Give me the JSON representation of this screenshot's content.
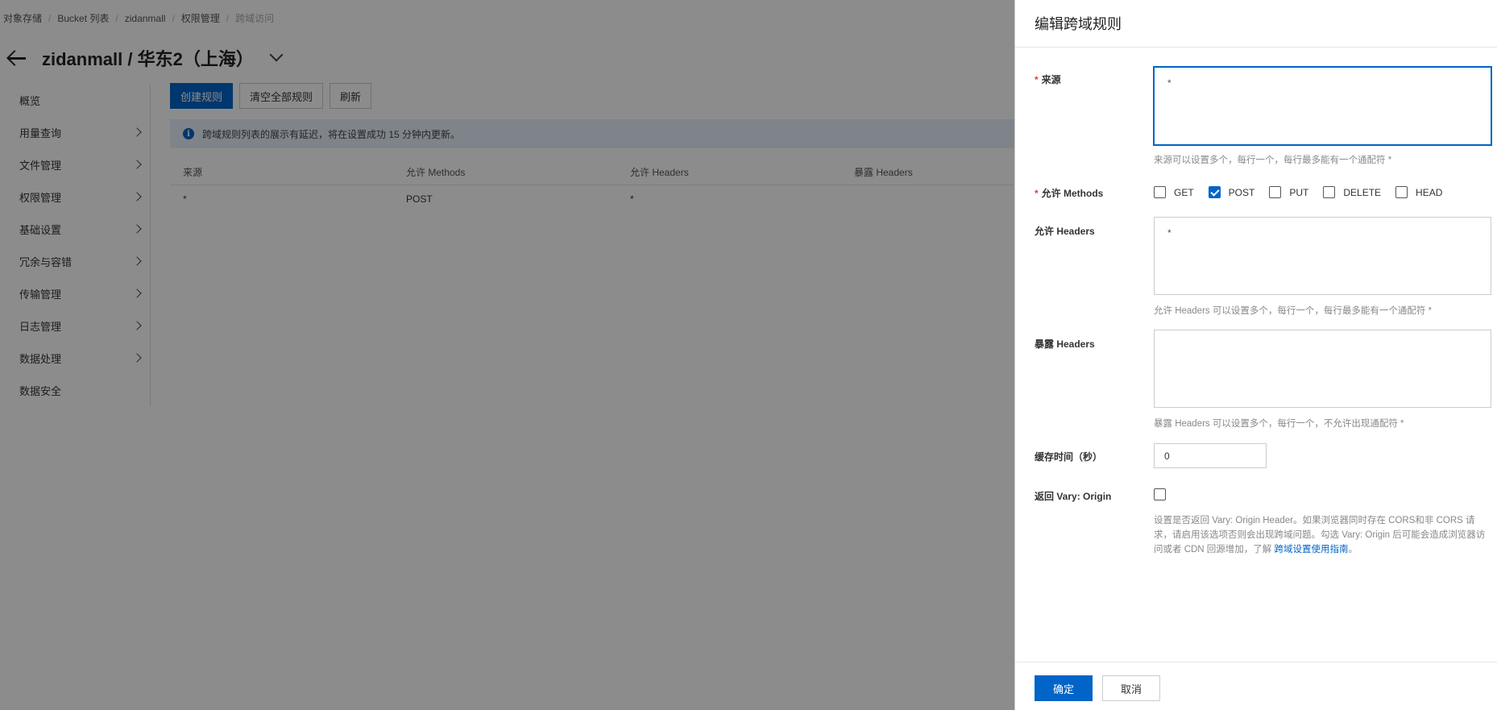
{
  "breadcrumb": {
    "items": [
      "对象存储",
      "Bucket 列表",
      "zidanmall",
      "权限管理"
    ],
    "current": "跨域访问"
  },
  "header": {
    "title": "zidanmall / 华东2（上海）"
  },
  "sidebar": {
    "items": [
      {
        "label": "概览"
      },
      {
        "label": "用量查询"
      },
      {
        "label": "文件管理"
      },
      {
        "label": "权限管理"
      },
      {
        "label": "基础设置"
      },
      {
        "label": "冗余与容错"
      },
      {
        "label": "传输管理"
      },
      {
        "label": "日志管理"
      },
      {
        "label": "数据处理"
      },
      {
        "label": "数据安全"
      }
    ]
  },
  "toolbar": {
    "create_label": "创建规则",
    "clear_label": "清空全部规则",
    "refresh_label": "刷新"
  },
  "notice": {
    "icon": "info-icon",
    "text": "跨域规则列表的展示有延迟，将在设置成功 15 分钟内更新。"
  },
  "table": {
    "columns": [
      "来源",
      "允许 Methods",
      "允许 Headers",
      "暴露 Headers"
    ],
    "rows": [
      [
        "*",
        "POST",
        "*",
        ""
      ]
    ]
  },
  "drawer": {
    "title": "编辑跨域规则",
    "origin": {
      "label": "来源",
      "value": "*",
      "help": "来源可以设置多个，每行一个，每行最多能有一个通配符 *"
    },
    "methods": {
      "label": "允许 Methods",
      "options": [
        {
          "label": "GET",
          "checked": false
        },
        {
          "label": "POST",
          "checked": true
        },
        {
          "label": "PUT",
          "checked": false
        },
        {
          "label": "DELETE",
          "checked": false
        },
        {
          "label": "HEAD",
          "checked": false
        }
      ]
    },
    "allow_headers": {
      "label": "允许 Headers",
      "value": "*",
      "help": "允许 Headers 可以设置多个，每行一个，每行最多能有一个通配符 *"
    },
    "expose_headers": {
      "label": "暴露 Headers",
      "value": "",
      "help": "暴露 Headers 可以设置多个，每行一个，不允许出现通配符 *"
    },
    "cache": {
      "label": "缓存时间（秒）",
      "value": "0"
    },
    "vary": {
      "label": "返回 Vary: Origin",
      "checked": false,
      "help": "设置是否返回 Vary: Origin Header。如果浏览器同时存在 CORS和非 CORS 请求，请启用该选项否则会出现跨域问题。勾选 Vary: Origin 后可能会造成浏览器访问或者 CDN 回源增加，了解 ",
      "link": "跨域设置使用指南",
      "tail": "。"
    },
    "confirm_label": "确定",
    "cancel_label": "取消"
  },
  "colors": {
    "primary": "#0064c8",
    "required": "#e43c3c",
    "notice_bg": "#e6f0fb"
  }
}
